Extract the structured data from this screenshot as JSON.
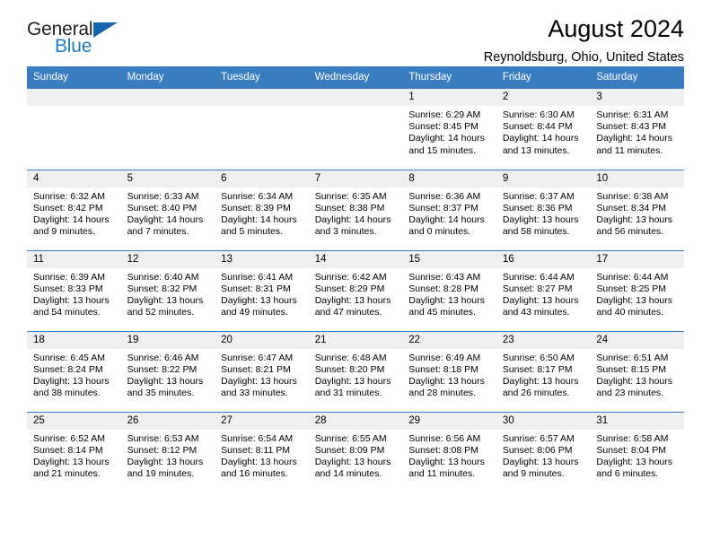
{
  "brand": {
    "name_part1": "General",
    "name_part2": "Blue",
    "logo_icon": "triangle-logo-icon"
  },
  "header": {
    "title": "August 2024",
    "location": "Reynoldsburg, Ohio, United States"
  },
  "calendar": {
    "weekday_headers": [
      "Sunday",
      "Monday",
      "Tuesday",
      "Wednesday",
      "Thursday",
      "Friday",
      "Saturday"
    ],
    "accent_color": "#3a7cc0",
    "daynum_band_color": "#efefef",
    "weeks": [
      [
        {
          "day": "",
          "empty": true
        },
        {
          "day": "",
          "empty": true
        },
        {
          "day": "",
          "empty": true
        },
        {
          "day": "",
          "empty": true
        },
        {
          "day": "1",
          "sunrise": "Sunrise: 6:29 AM",
          "sunset": "Sunset: 8:45 PM",
          "daylight1": "Daylight: 14 hours",
          "daylight2": "and 15 minutes."
        },
        {
          "day": "2",
          "sunrise": "Sunrise: 6:30 AM",
          "sunset": "Sunset: 8:44 PM",
          "daylight1": "Daylight: 14 hours",
          "daylight2": "and 13 minutes."
        },
        {
          "day": "3",
          "sunrise": "Sunrise: 6:31 AM",
          "sunset": "Sunset: 8:43 PM",
          "daylight1": "Daylight: 14 hours",
          "daylight2": "and 11 minutes."
        }
      ],
      [
        {
          "day": "4",
          "sunrise": "Sunrise: 6:32 AM",
          "sunset": "Sunset: 8:42 PM",
          "daylight1": "Daylight: 14 hours",
          "daylight2": "and 9 minutes."
        },
        {
          "day": "5",
          "sunrise": "Sunrise: 6:33 AM",
          "sunset": "Sunset: 8:40 PM",
          "daylight1": "Daylight: 14 hours",
          "daylight2": "and 7 minutes."
        },
        {
          "day": "6",
          "sunrise": "Sunrise: 6:34 AM",
          "sunset": "Sunset: 8:39 PM",
          "daylight1": "Daylight: 14 hours",
          "daylight2": "and 5 minutes."
        },
        {
          "day": "7",
          "sunrise": "Sunrise: 6:35 AM",
          "sunset": "Sunset: 8:38 PM",
          "daylight1": "Daylight: 14 hours",
          "daylight2": "and 3 minutes."
        },
        {
          "day": "8",
          "sunrise": "Sunrise: 6:36 AM",
          "sunset": "Sunset: 8:37 PM",
          "daylight1": "Daylight: 14 hours",
          "daylight2": "and 0 minutes."
        },
        {
          "day": "9",
          "sunrise": "Sunrise: 6:37 AM",
          "sunset": "Sunset: 8:36 PM",
          "daylight1": "Daylight: 13 hours",
          "daylight2": "and 58 minutes."
        },
        {
          "day": "10",
          "sunrise": "Sunrise: 6:38 AM",
          "sunset": "Sunset: 8:34 PM",
          "daylight1": "Daylight: 13 hours",
          "daylight2": "and 56 minutes."
        }
      ],
      [
        {
          "day": "11",
          "sunrise": "Sunrise: 6:39 AM",
          "sunset": "Sunset: 8:33 PM",
          "daylight1": "Daylight: 13 hours",
          "daylight2": "and 54 minutes."
        },
        {
          "day": "12",
          "sunrise": "Sunrise: 6:40 AM",
          "sunset": "Sunset: 8:32 PM",
          "daylight1": "Daylight: 13 hours",
          "daylight2": "and 52 minutes."
        },
        {
          "day": "13",
          "sunrise": "Sunrise: 6:41 AM",
          "sunset": "Sunset: 8:31 PM",
          "daylight1": "Daylight: 13 hours",
          "daylight2": "and 49 minutes."
        },
        {
          "day": "14",
          "sunrise": "Sunrise: 6:42 AM",
          "sunset": "Sunset: 8:29 PM",
          "daylight1": "Daylight: 13 hours",
          "daylight2": "and 47 minutes."
        },
        {
          "day": "15",
          "sunrise": "Sunrise: 6:43 AM",
          "sunset": "Sunset: 8:28 PM",
          "daylight1": "Daylight: 13 hours",
          "daylight2": "and 45 minutes."
        },
        {
          "day": "16",
          "sunrise": "Sunrise: 6:44 AM",
          "sunset": "Sunset: 8:27 PM",
          "daylight1": "Daylight: 13 hours",
          "daylight2": "and 43 minutes."
        },
        {
          "day": "17",
          "sunrise": "Sunrise: 6:44 AM",
          "sunset": "Sunset: 8:25 PM",
          "daylight1": "Daylight: 13 hours",
          "daylight2": "and 40 minutes."
        }
      ],
      [
        {
          "day": "18",
          "sunrise": "Sunrise: 6:45 AM",
          "sunset": "Sunset: 8:24 PM",
          "daylight1": "Daylight: 13 hours",
          "daylight2": "and 38 minutes."
        },
        {
          "day": "19",
          "sunrise": "Sunrise: 6:46 AM",
          "sunset": "Sunset: 8:22 PM",
          "daylight1": "Daylight: 13 hours",
          "daylight2": "and 35 minutes."
        },
        {
          "day": "20",
          "sunrise": "Sunrise: 6:47 AM",
          "sunset": "Sunset: 8:21 PM",
          "daylight1": "Daylight: 13 hours",
          "daylight2": "and 33 minutes."
        },
        {
          "day": "21",
          "sunrise": "Sunrise: 6:48 AM",
          "sunset": "Sunset: 8:20 PM",
          "daylight1": "Daylight: 13 hours",
          "daylight2": "and 31 minutes."
        },
        {
          "day": "22",
          "sunrise": "Sunrise: 6:49 AM",
          "sunset": "Sunset: 8:18 PM",
          "daylight1": "Daylight: 13 hours",
          "daylight2": "and 28 minutes."
        },
        {
          "day": "23",
          "sunrise": "Sunrise: 6:50 AM",
          "sunset": "Sunset: 8:17 PM",
          "daylight1": "Daylight: 13 hours",
          "daylight2": "and 26 minutes."
        },
        {
          "day": "24",
          "sunrise": "Sunrise: 6:51 AM",
          "sunset": "Sunset: 8:15 PM",
          "daylight1": "Daylight: 13 hours",
          "daylight2": "and 23 minutes."
        }
      ],
      [
        {
          "day": "25",
          "sunrise": "Sunrise: 6:52 AM",
          "sunset": "Sunset: 8:14 PM",
          "daylight1": "Daylight: 13 hours",
          "daylight2": "and 21 minutes."
        },
        {
          "day": "26",
          "sunrise": "Sunrise: 6:53 AM",
          "sunset": "Sunset: 8:12 PM",
          "daylight1": "Daylight: 13 hours",
          "daylight2": "and 19 minutes."
        },
        {
          "day": "27",
          "sunrise": "Sunrise: 6:54 AM",
          "sunset": "Sunset: 8:11 PM",
          "daylight1": "Daylight: 13 hours",
          "daylight2": "and 16 minutes."
        },
        {
          "day": "28",
          "sunrise": "Sunrise: 6:55 AM",
          "sunset": "Sunset: 8:09 PM",
          "daylight1": "Daylight: 13 hours",
          "daylight2": "and 14 minutes."
        },
        {
          "day": "29",
          "sunrise": "Sunrise: 6:56 AM",
          "sunset": "Sunset: 8:08 PM",
          "daylight1": "Daylight: 13 hours",
          "daylight2": "and 11 minutes."
        },
        {
          "day": "30",
          "sunrise": "Sunrise: 6:57 AM",
          "sunset": "Sunset: 8:06 PM",
          "daylight1": "Daylight: 13 hours",
          "daylight2": "and 9 minutes."
        },
        {
          "day": "31",
          "sunrise": "Sunrise: 6:58 AM",
          "sunset": "Sunset: 8:04 PM",
          "daylight1": "Daylight: 13 hours",
          "daylight2": "and 6 minutes."
        }
      ]
    ]
  }
}
